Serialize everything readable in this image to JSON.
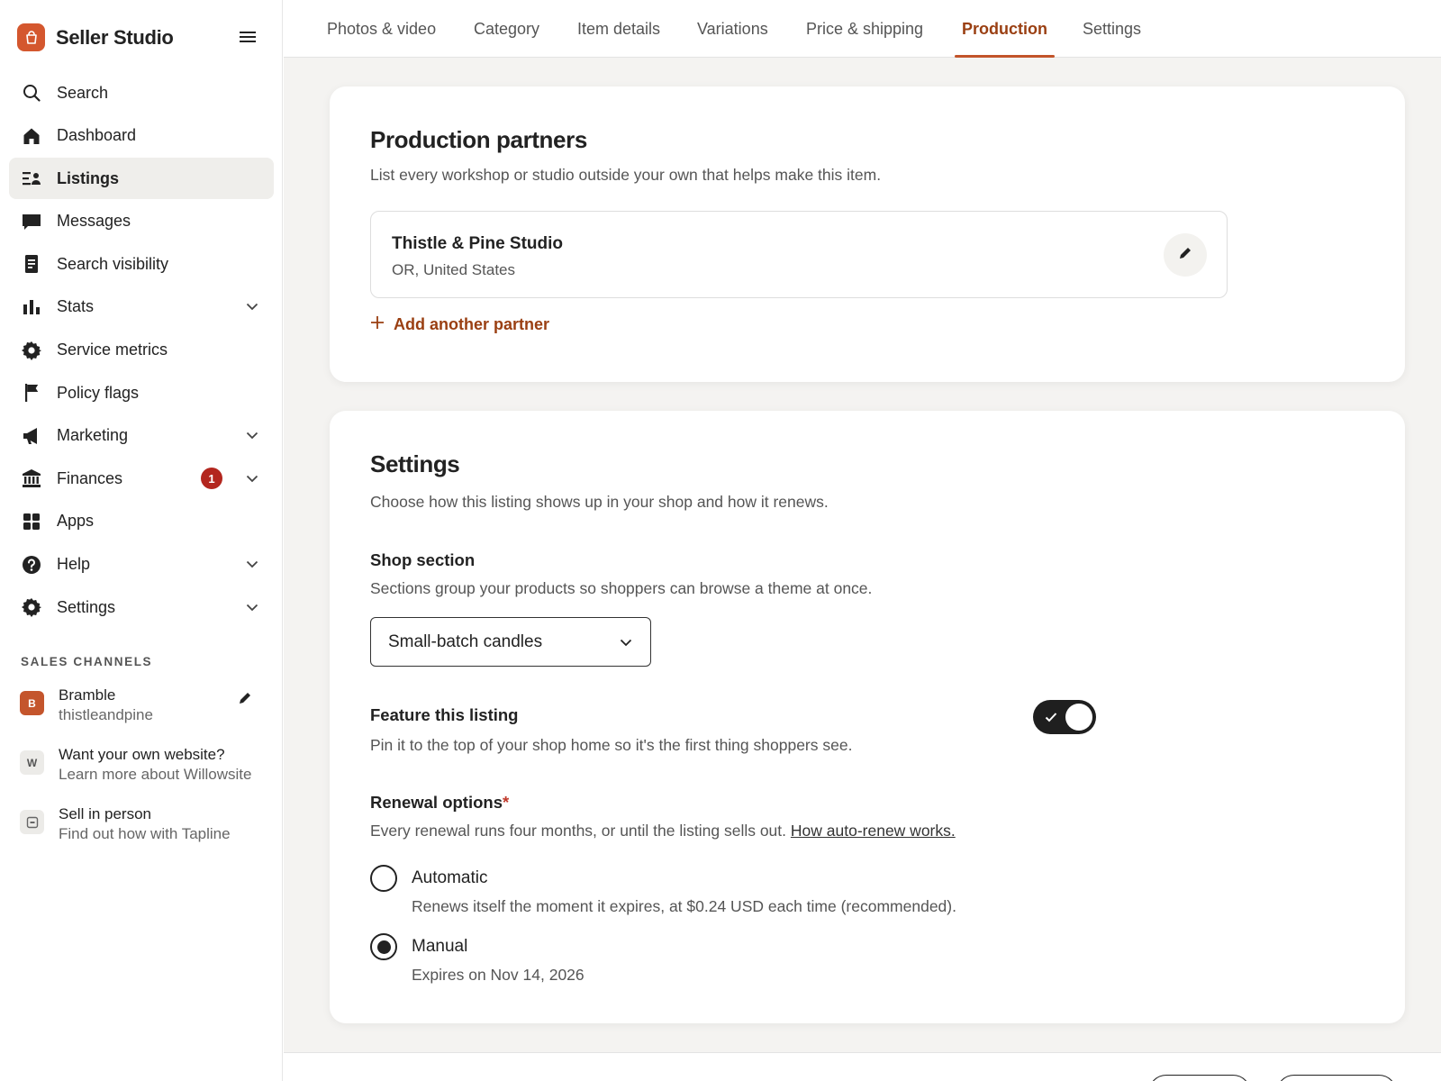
{
  "brand": {
    "name": "Seller Studio",
    "logo_icon": "shopping-bag-icon"
  },
  "nav": [
    {
      "label": "Search",
      "icon": "search-icon"
    },
    {
      "label": "Dashboard",
      "icon": "home-icon"
    },
    {
      "label": "Listings",
      "icon": "listings-icon",
      "active": true
    },
    {
      "label": "Messages",
      "icon": "message-icon"
    },
    {
      "label": "Search visibility",
      "icon": "document-icon"
    },
    {
      "label": "Stats",
      "icon": "bar-chart-icon",
      "expandable": true
    },
    {
      "label": "Service metrics",
      "icon": "gear-icon"
    },
    {
      "label": "Policy flags",
      "icon": "flag-icon"
    },
    {
      "label": "Marketing",
      "icon": "megaphone-icon",
      "expandable": true
    },
    {
      "label": "Finances",
      "icon": "bank-icon",
      "expandable": true,
      "badge": "1"
    },
    {
      "label": "Apps",
      "icon": "grid-icon"
    },
    {
      "label": "Help",
      "icon": "help-icon",
      "expandable": true
    },
    {
      "label": "Settings",
      "icon": "gear-icon",
      "expandable": true
    }
  ],
  "sales_channels": {
    "title": "SALES CHANNELS",
    "items": [
      {
        "avatar": "B",
        "name": "Bramble",
        "sub": "thistleandpine"
      },
      {
        "avatar": "W",
        "name": "Want your own website?",
        "sub": "Learn more about Willowsite"
      },
      {
        "avatar": "",
        "name": "Sell in person",
        "sub": "Find out how with Tapline"
      }
    ]
  },
  "tabs": [
    "Photos & video",
    "Category",
    "Item details",
    "Variations",
    "Price & shipping",
    "Production",
    "Settings"
  ],
  "active_tab": "Production",
  "production": {
    "title": "Production partners",
    "subtitle": "List every workshop or studio outside your own that helps make this item.",
    "partner": {
      "name": "Thistle & Pine Studio",
      "location": "OR, United States"
    },
    "add_label": "Add another partner"
  },
  "settings": {
    "title": "Settings",
    "subtitle": "Choose how this listing shows up in your shop and how it renews.",
    "shop_section": {
      "title": "Shop section",
      "desc": "Sections group your products so shoppers can browse a theme at once.",
      "selected": "Small-batch candles"
    },
    "feature": {
      "title": "Feature this listing",
      "desc": "Pin it to the top of your shop home so it's the first thing shoppers see.",
      "enabled": true
    },
    "renewal": {
      "title": "Renewal options",
      "required_mark": "*",
      "desc": "Every renewal runs four months, or until the listing sells out.",
      "link": "How auto-renew works.",
      "options": [
        {
          "label": "Automatic",
          "desc": "Renews itself the moment it expires, at $0.24 USD each time (recommended).",
          "selected": false
        },
        {
          "label": "Manual",
          "desc": "Expires on Nov 14, 2026",
          "selected": true
        }
      ]
    }
  },
  "colors": {
    "accent": "#9a3f12",
    "brand": "#d4572e",
    "badge": "#b3261e"
  }
}
